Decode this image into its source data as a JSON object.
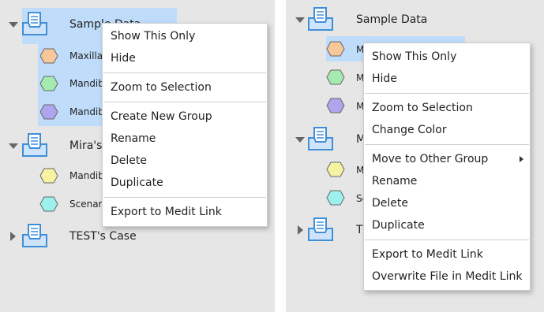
{
  "left_panel": {
    "groups": [
      {
        "name": "Sample Data",
        "expanded": true,
        "items": [
          {
            "name": "Maxilla",
            "color": "#f8c79b"
          },
          {
            "name": "Mandible",
            "color": "#a5ebb1"
          },
          {
            "name": "Mandible",
            "color": "#aea5ee"
          }
        ]
      },
      {
        "name": "Mira's Case",
        "expanded": true,
        "items": [
          {
            "name": "Mandible",
            "color": "#f6f3a3"
          },
          {
            "name": "Scenario",
            "color": "#9cf1ef"
          }
        ]
      },
      {
        "name": "TEST's Case",
        "expanded": false,
        "items": []
      }
    ],
    "context_menu": {
      "items": [
        {
          "label": "Show This Only"
        },
        {
          "label": "Hide"
        },
        {
          "label": "Zoom to Selection"
        },
        {
          "label": "Create New Group"
        },
        {
          "label": "Rename"
        },
        {
          "label": "Delete"
        },
        {
          "label": "Duplicate"
        },
        {
          "label": "Export to Medit Link"
        }
      ]
    }
  },
  "right_panel": {
    "groups": [
      {
        "name": "Sample Data",
        "expanded": true,
        "items": [
          {
            "name": "M",
            "color": "#f8c79b"
          },
          {
            "name": "M",
            "color": "#a5ebb1"
          },
          {
            "name": "M",
            "color": "#aea5ee"
          }
        ]
      },
      {
        "name": "M",
        "expanded": true,
        "items": [
          {
            "name": "M",
            "color": "#f6f3a3"
          },
          {
            "name": "Sc",
            "color": "#9cf1ef"
          }
        ]
      },
      {
        "name": "T",
        "expanded": false,
        "items": []
      }
    ],
    "context_menu": {
      "items": [
        {
          "label": "Show This Only"
        },
        {
          "label": "Hide"
        },
        {
          "label": "Zoom to Selection"
        },
        {
          "label": "Change Color"
        },
        {
          "label": "Move to Other Group",
          "has_submenu": true
        },
        {
          "label": "Rename"
        },
        {
          "label": "Delete"
        },
        {
          "label": "Duplicate"
        },
        {
          "label": "Export to Medit Link"
        },
        {
          "label": "Overwrite File in Medit Link"
        }
      ]
    }
  },
  "colors": {
    "panel_bg": "#e6e6e6",
    "selection": "#bfdcfa",
    "folder_icon": "#3f8fd8",
    "menu_bg": "#ffffff"
  }
}
